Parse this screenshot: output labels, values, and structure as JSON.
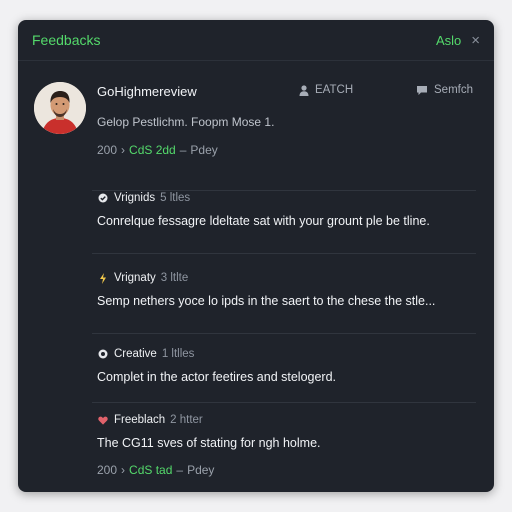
{
  "window": {
    "title": "Feedbacks",
    "auto_label": "Aslo",
    "close_glyph": "×"
  },
  "profile": {
    "name": "GoHighmereview",
    "watch_label": "EATCH",
    "search_label": "Semfch",
    "subtitle": "Gelop Pestlichm. Foopm Mose 1.",
    "meta": {
      "count": "200",
      "chevron": "›",
      "highlight": "CdS 2dd",
      "sep": "–",
      "day": "Pdey"
    }
  },
  "items": [
    {
      "icon": "circle-check-icon",
      "label": "Vrignids",
      "count": "5 ltles",
      "text": "Conrelque fessagre ldeltate sat with your grount ple be tline."
    },
    {
      "icon": "bolt-icon",
      "icon_color": "#f2c94c",
      "label": "Vrignaty",
      "count": "3 ltlte",
      "text": "Semp nethers yoce lo ipds in the saert to the chese the stle..."
    },
    {
      "icon": "circle-dot-icon",
      "label": "Creative",
      "count": "1 ltlles",
      "text": "Complet in the actor feetires and stelogerd."
    },
    {
      "icon": "heart-icon",
      "icon_color": "#e0626b",
      "label": "Freeblach",
      "count": "2 htter",
      "text": "The CG11 sves of stating for ngh holme.",
      "meta": {
        "count": "200",
        "chevron": "›",
        "highlight": "CdS tad",
        "sep": "–",
        "day": "Pdey"
      }
    }
  ],
  "colors": {
    "accent": "#54d96b",
    "panel_bg": "#1f232b",
    "page_bg": "#f1f1f3"
  }
}
